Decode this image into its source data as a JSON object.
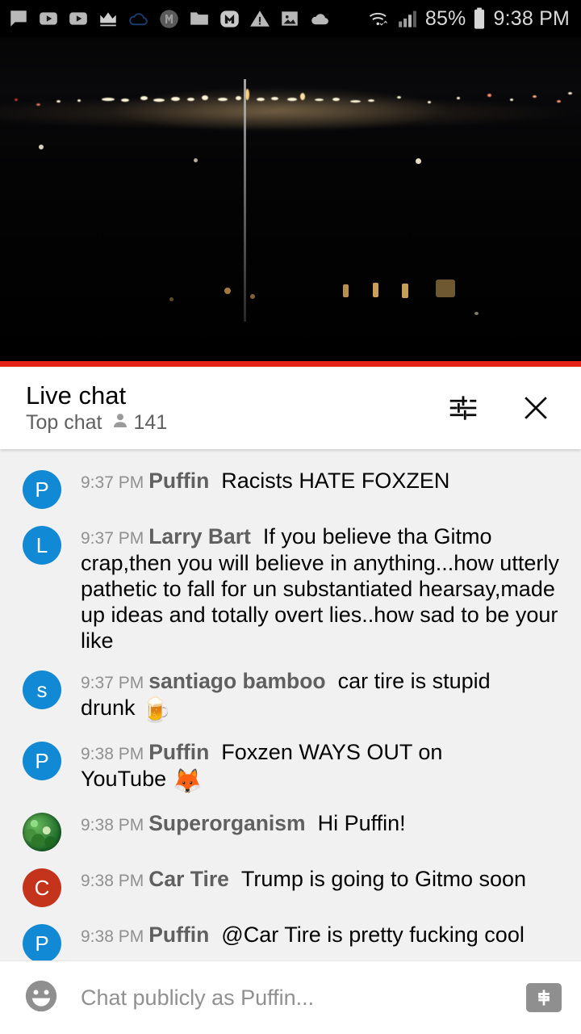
{
  "statusbar": {
    "icons": [
      {
        "name": "chat-bubble-icon"
      },
      {
        "name": "youtube-play-icon"
      },
      {
        "name": "youtube-play-icon-2"
      },
      {
        "name": "crown-icon"
      },
      {
        "name": "cloud-outline-icon"
      },
      {
        "name": "monogram-m-circle-icon"
      },
      {
        "name": "folder-icon"
      },
      {
        "name": "m-badge-icon"
      },
      {
        "name": "warning-triangle-icon"
      },
      {
        "name": "image-icon"
      },
      {
        "name": "cloud-filled-icon"
      }
    ],
    "wifi": "wifi-icon",
    "signal": "cell-signal-icon",
    "battery_percent": "85%",
    "battery": "battery-icon",
    "clock": "9:38 PM"
  },
  "video": {
    "name": "live-stream-video",
    "progress_color": "#e62117"
  },
  "chat_header": {
    "title": "Live chat",
    "mode": "Top chat",
    "viewer_icon": "person-icon",
    "viewer_count": "141",
    "settings_icon": "tune-sliders-icon",
    "close_icon": "close-icon"
  },
  "messages": [
    {
      "avatar_letter": "P",
      "avatar_color": "#1189d4",
      "avatar_type": "letter",
      "time": "9:37 PM",
      "author": "Puffin",
      "text": "Racists HATE FOXZEN",
      "emoji": ""
    },
    {
      "avatar_letter": "L",
      "avatar_color": "#1189d4",
      "avatar_type": "letter",
      "time": "9:37 PM",
      "author": "Larry Bart",
      "text": "If you believe tha Gitmo crap,then you will believe in anything...how utterly pathetic to fall for un substantiated hearsay,made up ideas and totally overt lies..how sad to be your like",
      "emoji": ""
    },
    {
      "avatar_letter": "s",
      "avatar_color": "#1189d4",
      "avatar_type": "letter",
      "time": "9:37 PM",
      "author": "santiago bamboo",
      "text": "car tire is stupid drunk",
      "emoji": "🍺"
    },
    {
      "avatar_letter": "P",
      "avatar_color": "#1189d4",
      "avatar_type": "letter",
      "time": "9:38 PM",
      "author": "Puffin",
      "text": "Foxzen WAYS OUT on YouTube",
      "emoji": "🦊"
    },
    {
      "avatar_letter": "",
      "avatar_color": "#2f7a2a",
      "avatar_type": "globe",
      "time": "9:38 PM",
      "author": "Superorganism",
      "text": "Hi Puffin!",
      "emoji": ""
    },
    {
      "avatar_letter": "C",
      "avatar_color": "#c4331c",
      "avatar_type": "letter",
      "time": "9:38 PM",
      "author": "Car Tire",
      "text": "Trump is going to Gitmo soon",
      "emoji": ""
    },
    {
      "avatar_letter": "P",
      "avatar_color": "#1189d4",
      "avatar_type": "letter",
      "time": "9:38 PM",
      "author": "Puffin",
      "text": "@Car Tire is pretty fucking cool",
      "emoji": ""
    }
  ],
  "composer": {
    "emoji_icon": "smiley-face-icon",
    "placeholder": "Chat publicly as Puffin...",
    "value": "",
    "superchat_icon": "dollar-bill-icon"
  }
}
